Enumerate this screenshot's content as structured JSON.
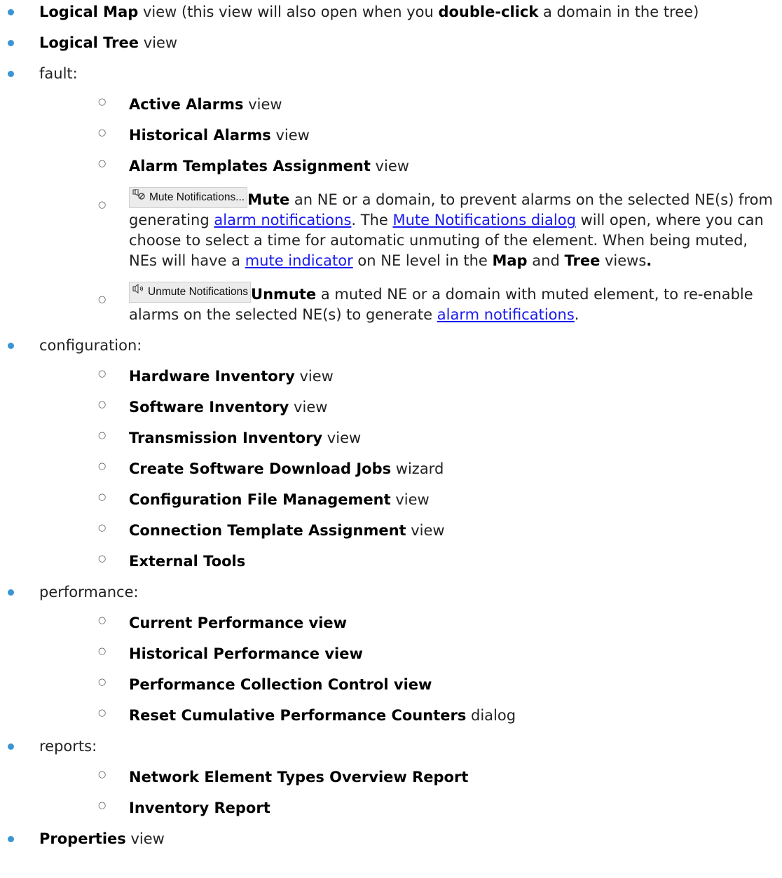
{
  "items": [
    {
      "b": "Logical Map",
      "t": " view (this view will also open when you ",
      "b2": "double-click",
      "t2": " a domain in the tree)"
    },
    {
      "b": "Logical Tree",
      "t": " view"
    },
    {
      "t": "fault:"
    },
    {
      "b": "Active Alarms",
      "t": " view"
    },
    {
      "b": "Historical Alarms",
      "t": " view"
    },
    {
      "b": "Alarm Templates Assignment",
      "t": " view"
    },
    {
      "t": "configuration:"
    },
    {
      "b": "Hardware Inventory",
      "t": " view"
    },
    {
      "b": "Software Inventory",
      "t": " view"
    },
    {
      "b": "Transmission Inventory",
      "t": " view"
    },
    {
      "b": "Create Software Download Jobs",
      "t": " wizard"
    },
    {
      "b": "Configuration File Management",
      "t": " view"
    },
    {
      "b": "Connection Template Assignment",
      "t": " view"
    },
    {
      "b": "External Tools"
    },
    {
      "t": "performance:"
    },
    {
      "b": "Current Performance view"
    },
    {
      "b": "Historical Performance view"
    },
    {
      "b": "Performance Collection Control view"
    },
    {
      "b": "Reset Cumulative Performance Counters",
      "t": " dialog"
    },
    {
      "t": "reports:"
    },
    {
      "b": "Network Element Types Overview Report"
    },
    {
      "b": "Inventory Report"
    },
    {
      "b": "Properties",
      "t": " view"
    }
  ],
  "mute": {
    "button_label": "Mute Notifications...",
    "icon": "speaker-mute-icon",
    "b1": "Mute",
    "t1": " an NE or a domain, to prevent alarms on the selected NE(s) from generating ",
    "link1": "alarm notifications",
    "t2": ". The ",
    "link2": "Mute Notifications dialog",
    "t3": " will open, where you can choose to select a time for automatic unmuting of the element. When being muted, NEs will have a ",
    "link3": "mute indicator",
    "t4": " on NE level in the ",
    "b2": "Map",
    "t5": " and ",
    "b3": "Tree",
    "t6": " views",
    "b4": "."
  },
  "unmute": {
    "button_label": "Unmute Notifications",
    "icon": "speaker-unmute-icon",
    "b1": "Unmute",
    "t1": " a muted NE or a domain with muted element, to re-enable alarms on the selected NE(s) to generate ",
    "link1": "alarm notifications",
    "t2": "."
  },
  "colors": {
    "bullet": "#3b95d3",
    "link": "#1a1aee",
    "button_bg": "#ececec"
  }
}
